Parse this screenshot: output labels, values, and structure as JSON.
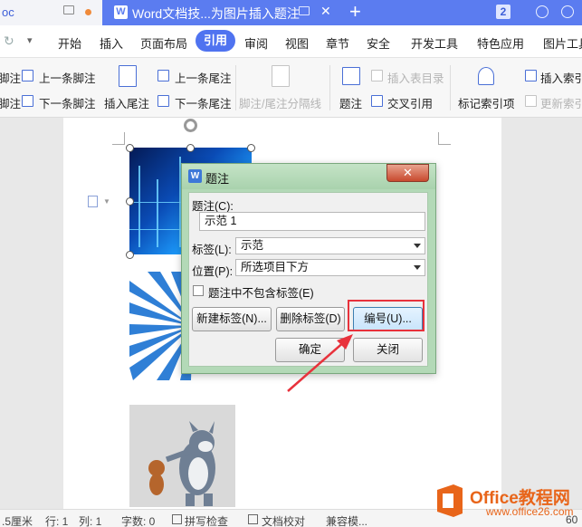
{
  "titlebar": {
    "left_tab": "oc",
    "doc_tab_title": "Word文档技...为图片插入题注",
    "new_tab": "+",
    "count_badge": "2"
  },
  "menu": {
    "items": [
      "开始",
      "插入",
      "页面布局",
      "引用",
      "审阅",
      "视图",
      "章节",
      "安全",
      "开发工具",
      "特色应用",
      "图片工具"
    ],
    "active": "引用"
  },
  "ribbon": {
    "left_cut": "脚注",
    "left_cut2": "脚注",
    "prev_footnote": "上一条脚注",
    "next_footnote": "下一条脚注",
    "insert_endnote": "插入尾注",
    "prev_endnote": "上一条尾注",
    "next_endnote": "下一条尾注",
    "separator_line": "脚注/尾注分隔线",
    "caption": "题注",
    "insert_table_of_figures": "插入表目录",
    "cross_reference": "交叉引用",
    "mark_index_entry": "标记索引项",
    "insert_index": "插入索引",
    "update_index": "更新索引"
  },
  "dialog": {
    "title": "题注",
    "close": "✕",
    "caption_label": "题注(C):",
    "caption_value": "示范 1",
    "label_label": "标签(L):",
    "label_value": "示范",
    "position_label": "位置(P):",
    "position_value": "所选项目下方",
    "exclude_label_checkbox": "题注中不包含标签(E)",
    "new_label_button": "新建标签(N)...",
    "delete_label_button": "删除标签(D)",
    "numbering_button": "编号(U)...",
    "ok_button": "确定",
    "close_button": "关闭"
  },
  "statusbar": {
    "position": ".5厘米",
    "line": "行: 1",
    "column": "列: 1",
    "word_count": "字数: 0",
    "spell_check": "拼写检查",
    "doc_proofread": "文档校对",
    "compat_mode": "兼容模...",
    "zoom": "60"
  },
  "watermark": {
    "line1": "Office教程网",
    "line2": "www.office26.com"
  },
  "colors": {
    "accent": "#4f73f0",
    "dialog_frame": "#b3d9b7",
    "highlight": "#e8323c"
  }
}
